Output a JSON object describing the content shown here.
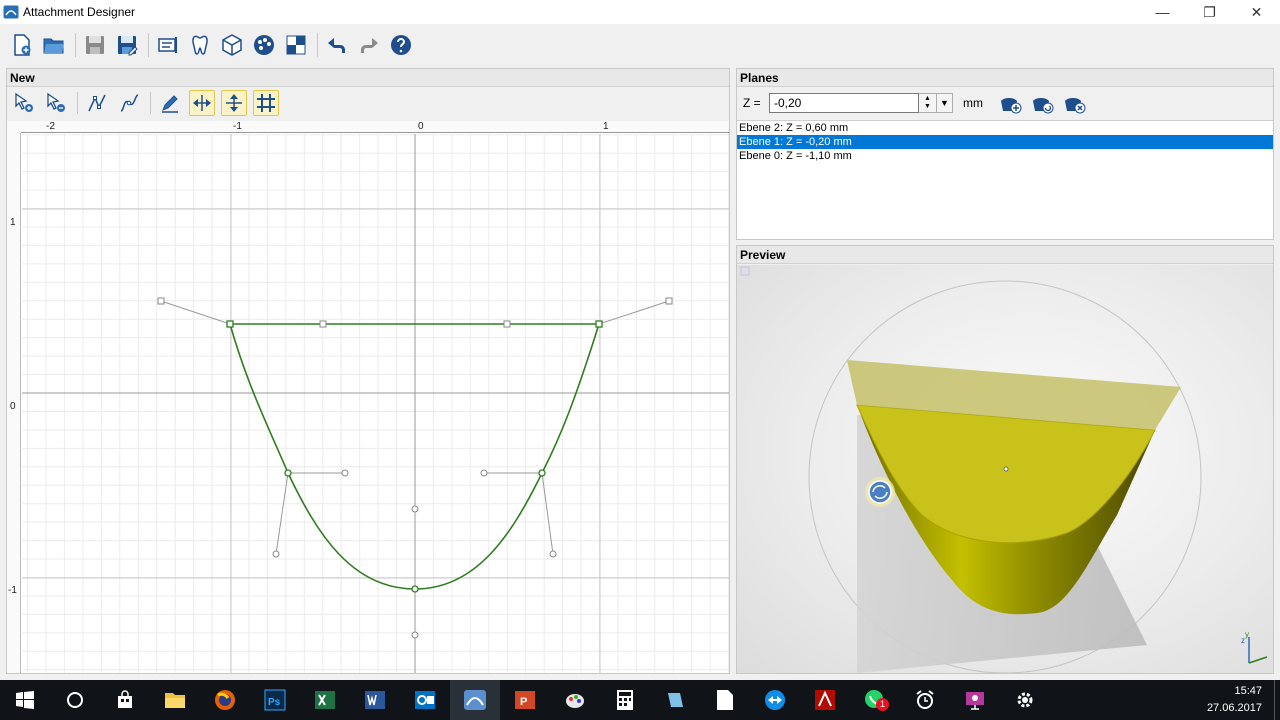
{
  "window": {
    "title": "Attachment Designer",
    "controls": {
      "minimize": "—",
      "restore": "❐",
      "close": "✕"
    }
  },
  "toolbar": {
    "icons": [
      "new-document-icon",
      "open-folder-icon",
      "save-icon",
      "save-as-icon",
      "attachment-settings-icon",
      "tooth-icon",
      "3d-box-icon",
      "palette-icon",
      "checker-icon",
      "undo-icon",
      "redo-icon",
      "help-icon"
    ]
  },
  "new_panel": {
    "title": "New",
    "tools": [
      "select-add-icon",
      "select-remove-icon",
      "curve-add-icon",
      "curve-smooth-icon",
      "pen-icon",
      "mirror-horizontal-icon",
      "mirror-vertical-icon",
      "grid-icon"
    ],
    "active_tools": [
      "mirror-horizontal-icon",
      "mirror-vertical-icon",
      "grid-icon"
    ],
    "ruler": {
      "x_ticks": [
        "-2",
        "-1",
        "0",
        "1"
      ],
      "y_ticks": [
        "1",
        "0",
        "-1"
      ]
    },
    "colors": {
      "curve": "#2e7d1e",
      "grid_minor": "#ececec",
      "grid_major": "#c8c8c8",
      "handle": "#888888"
    }
  },
  "planes_panel": {
    "title": "Planes",
    "z_label": "Z =",
    "z_value": "-0,20",
    "unit": "mm",
    "spin_up": "▲",
    "spin_down": "▼",
    "dropdown": "▼",
    "buttons": [
      "plane-add-icon",
      "plane-refresh-icon",
      "plane-delete-icon"
    ],
    "items": [
      {
        "label": "Ebene 2: Z = 0,60 mm",
        "selected": false
      },
      {
        "label": "Ebene 1: Z = -0,20 mm",
        "selected": true
      },
      {
        "label": "Ebene 0: Z = -1,10 mm",
        "selected": false
      }
    ]
  },
  "preview_panel": {
    "title": "Preview",
    "colors": {
      "body": "#9a9a00",
      "top_face": "#c9c21a",
      "cap": "#b8b65a"
    },
    "axes": {
      "y": "y",
      "z": "z"
    }
  },
  "taskbar": {
    "icons": [
      "windows-start-icon",
      "cortana-icon",
      "store-icon",
      "file-explorer-icon",
      "firefox-icon",
      "photoshop-icon",
      "excel-icon",
      "word-icon",
      "outlook-icon",
      "attachment-designer-icon",
      "powerpoint-icon",
      "paint-icon",
      "calculator-icon",
      "app-icon",
      "file-icon",
      "teamviewer-icon",
      "adobe-icon",
      "whatsapp-icon",
      "alarm-clock-icon",
      "presentation-icon",
      "settings-icon"
    ],
    "whatsapp_badge": "1",
    "time": "15:47",
    "date": "27.06.2017"
  }
}
